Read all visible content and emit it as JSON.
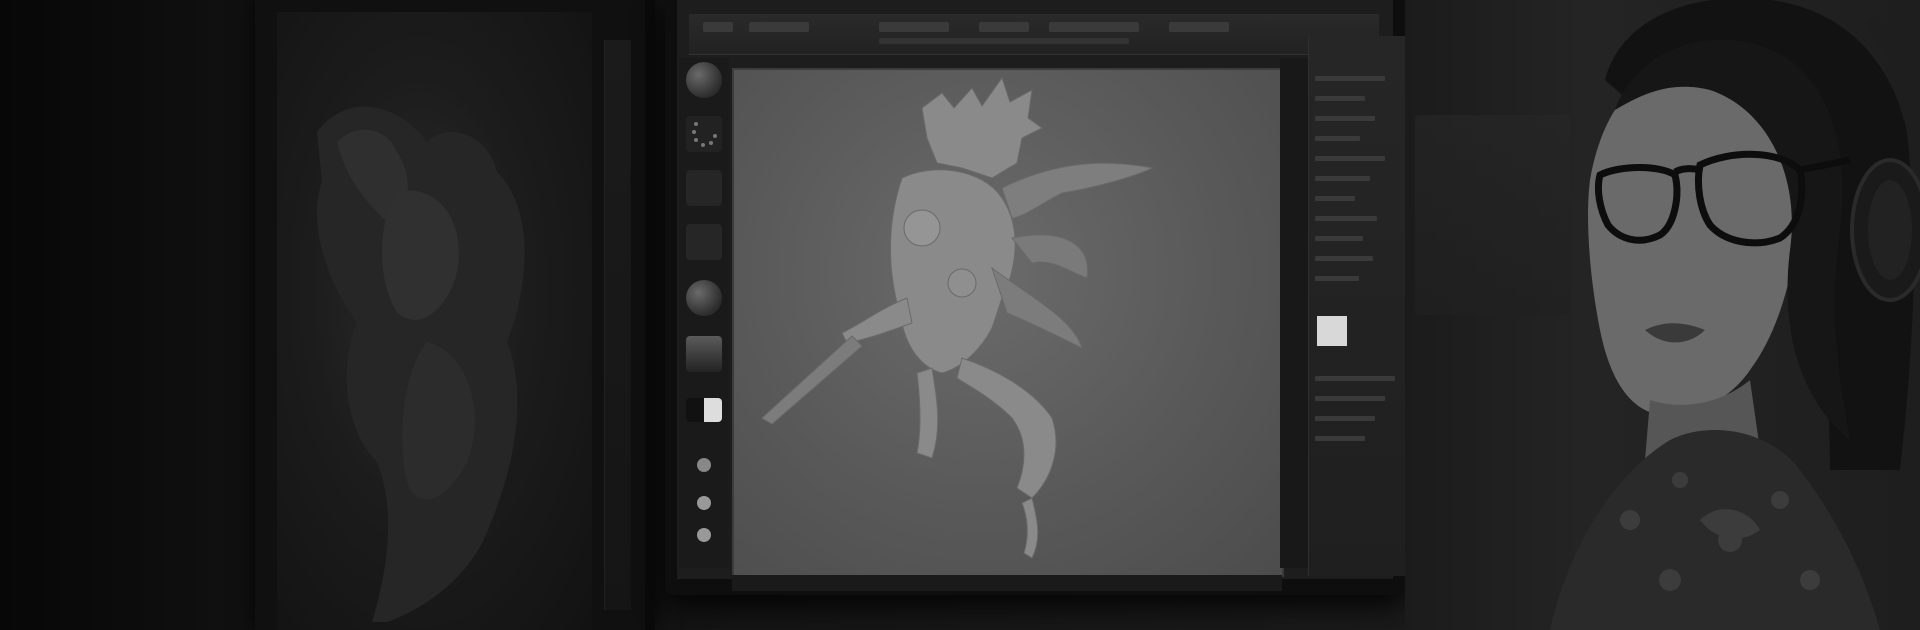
{
  "scene": {
    "description_tag": "photo",
    "tone": "grayscale-dark",
    "colors": {
      "background": "#0b0b0b",
      "screen_canvas": "#5f5f5f",
      "panel": "#222222",
      "skin": "#6e6e6e",
      "hair": "#151515"
    }
  },
  "elements": {
    "left_monitor_icon": "monitor-icon",
    "main_monitor_icon": "monitor-icon",
    "figure_icon": "sculpt-figure-icon",
    "person_icon": "person-icon",
    "headphones_icon": "headphones-icon",
    "glasses_icon": "glasses-icon"
  }
}
